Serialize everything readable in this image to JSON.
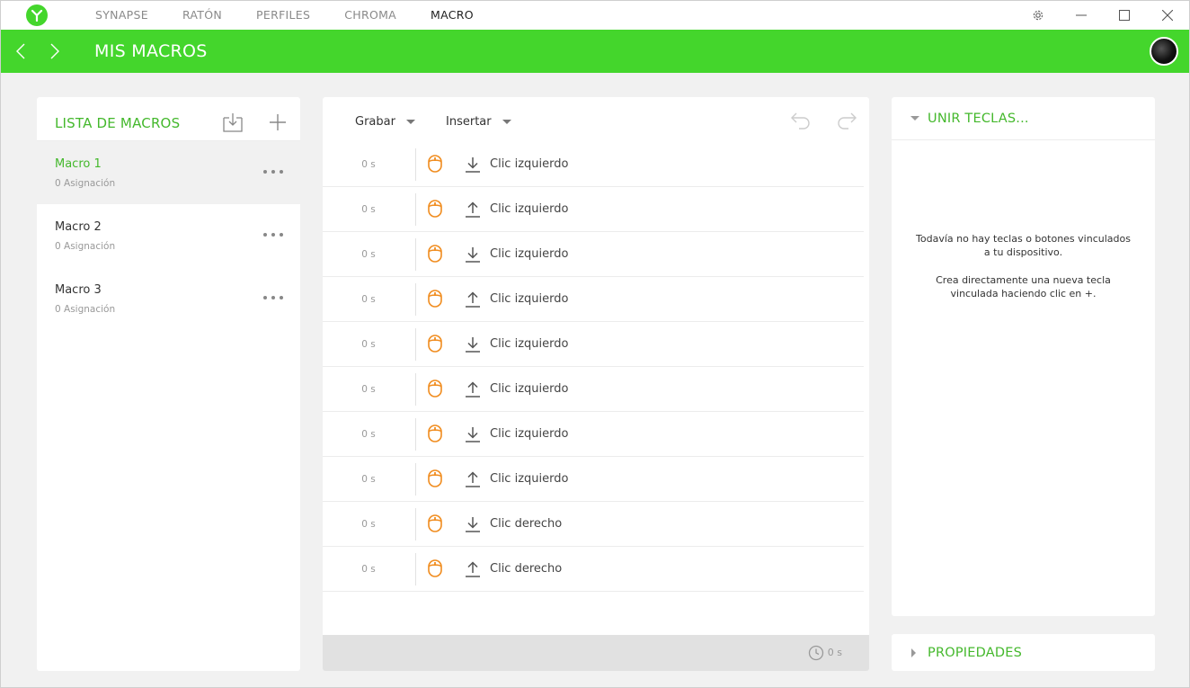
{
  "app": {
    "nav": [
      {
        "label": "SYNAPSE",
        "active": false
      },
      {
        "label": "RATÓN",
        "active": false
      },
      {
        "label": "PERFILES",
        "active": false
      },
      {
        "label": "CHROMA",
        "active": false
      },
      {
        "label": "MACRO",
        "active": true
      }
    ],
    "accent_color": "#44d62c",
    "window_controls": [
      "gear-icon",
      "minimize-icon",
      "maximize-icon",
      "close-icon"
    ]
  },
  "header": {
    "title": "MIS MACROS"
  },
  "macro_list": {
    "title": "LISTA DE MACROS",
    "items": [
      {
        "name": "Macro 1",
        "assignments": "0 Asignación",
        "selected": true
      },
      {
        "name": "Macro 2",
        "assignments": "0 Asignación",
        "selected": false
      },
      {
        "name": "Macro 3",
        "assignments": "0 Asignación",
        "selected": false
      }
    ]
  },
  "editor": {
    "record_label": "Grabar",
    "insert_label": "Insertar",
    "rows": [
      {
        "delay": "0 s",
        "direction": "down",
        "label": "Clic izquierdo"
      },
      {
        "delay": "0 s",
        "direction": "up",
        "label": "Clic izquierdo"
      },
      {
        "delay": "0 s",
        "direction": "down",
        "label": "Clic izquierdo"
      },
      {
        "delay": "0 s",
        "direction": "up",
        "label": "Clic izquierdo"
      },
      {
        "delay": "0 s",
        "direction": "down",
        "label": "Clic izquierdo"
      },
      {
        "delay": "0 s",
        "direction": "up",
        "label": "Clic izquierdo"
      },
      {
        "delay": "0 s",
        "direction": "down",
        "label": "Clic izquierdo"
      },
      {
        "delay": "0 s",
        "direction": "up",
        "label": "Clic izquierdo"
      },
      {
        "delay": "0 s",
        "direction": "down",
        "label": "Clic derecho"
      },
      {
        "delay": "0 s",
        "direction": "up",
        "label": "Clic derecho"
      }
    ],
    "total_time": "0 s"
  },
  "bind_keys": {
    "title": "UNIR TECLAS...",
    "empty_line1": "Todavía no hay teclas o botones vinculados a tu dispositivo.",
    "empty_line2": "Crea directamente una nueva tecla vinculada haciendo clic en +."
  },
  "properties": {
    "title": "PROPIEDADES"
  }
}
